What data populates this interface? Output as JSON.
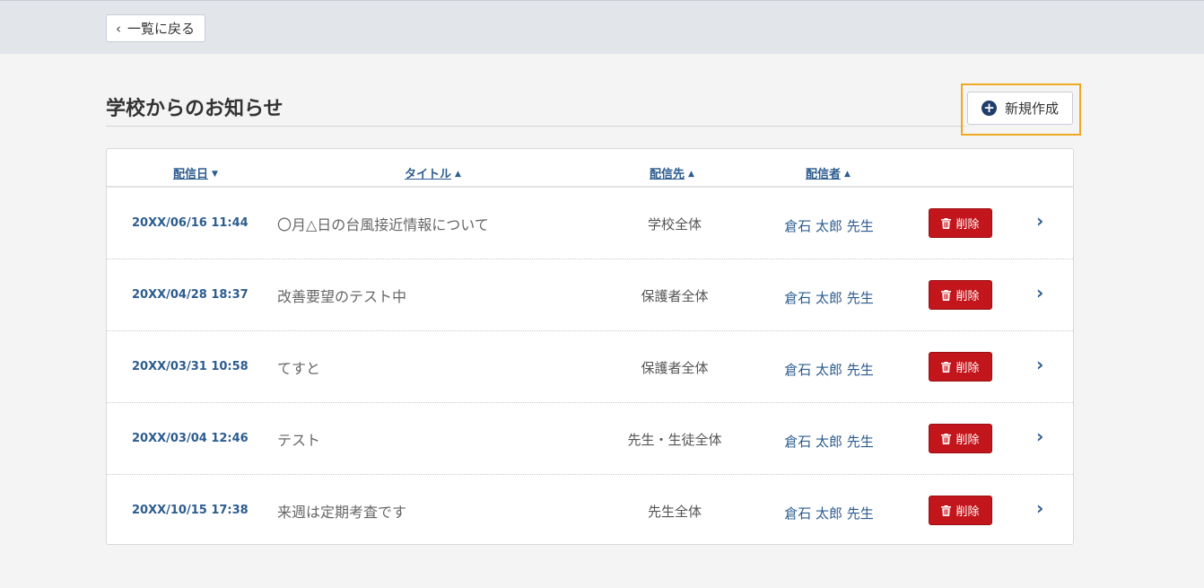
{
  "nav": {
    "back_label": "一覧に戻る"
  },
  "page": {
    "title": "学校からのお知らせ",
    "new_label": "新規作成"
  },
  "table": {
    "headers": {
      "date": "配信日",
      "title": "タイトル",
      "target": "配信先",
      "sender": "配信者"
    },
    "delete_label": "削除",
    "rows": [
      {
        "date": "20XX/06/16 11:44",
        "title": "〇月△日の台風接近情報について",
        "target": "学校全体",
        "sender": "倉石 太郎 先生"
      },
      {
        "date": "20XX/04/28 18:37",
        "title": "改善要望のテスト中",
        "target": "保護者全体",
        "sender": "倉石 太郎 先生"
      },
      {
        "date": "20XX/03/31 10:58",
        "title": "てすと",
        "target": "保護者全体",
        "sender": "倉石 太郎 先生"
      },
      {
        "date": "20XX/03/04 12:46",
        "title": "テスト",
        "target": "先生・生徒全体",
        "sender": "倉石 太郎 先生"
      },
      {
        "date": "20XX/10/15 17:38",
        "title": "来週は定期考査です",
        "target": "先生全体",
        "sender": "倉石 太郎 先生"
      }
    ]
  },
  "colors": {
    "accent": "#2d5c8f",
    "danger": "#c3161c",
    "highlight": "#f0a81f"
  }
}
